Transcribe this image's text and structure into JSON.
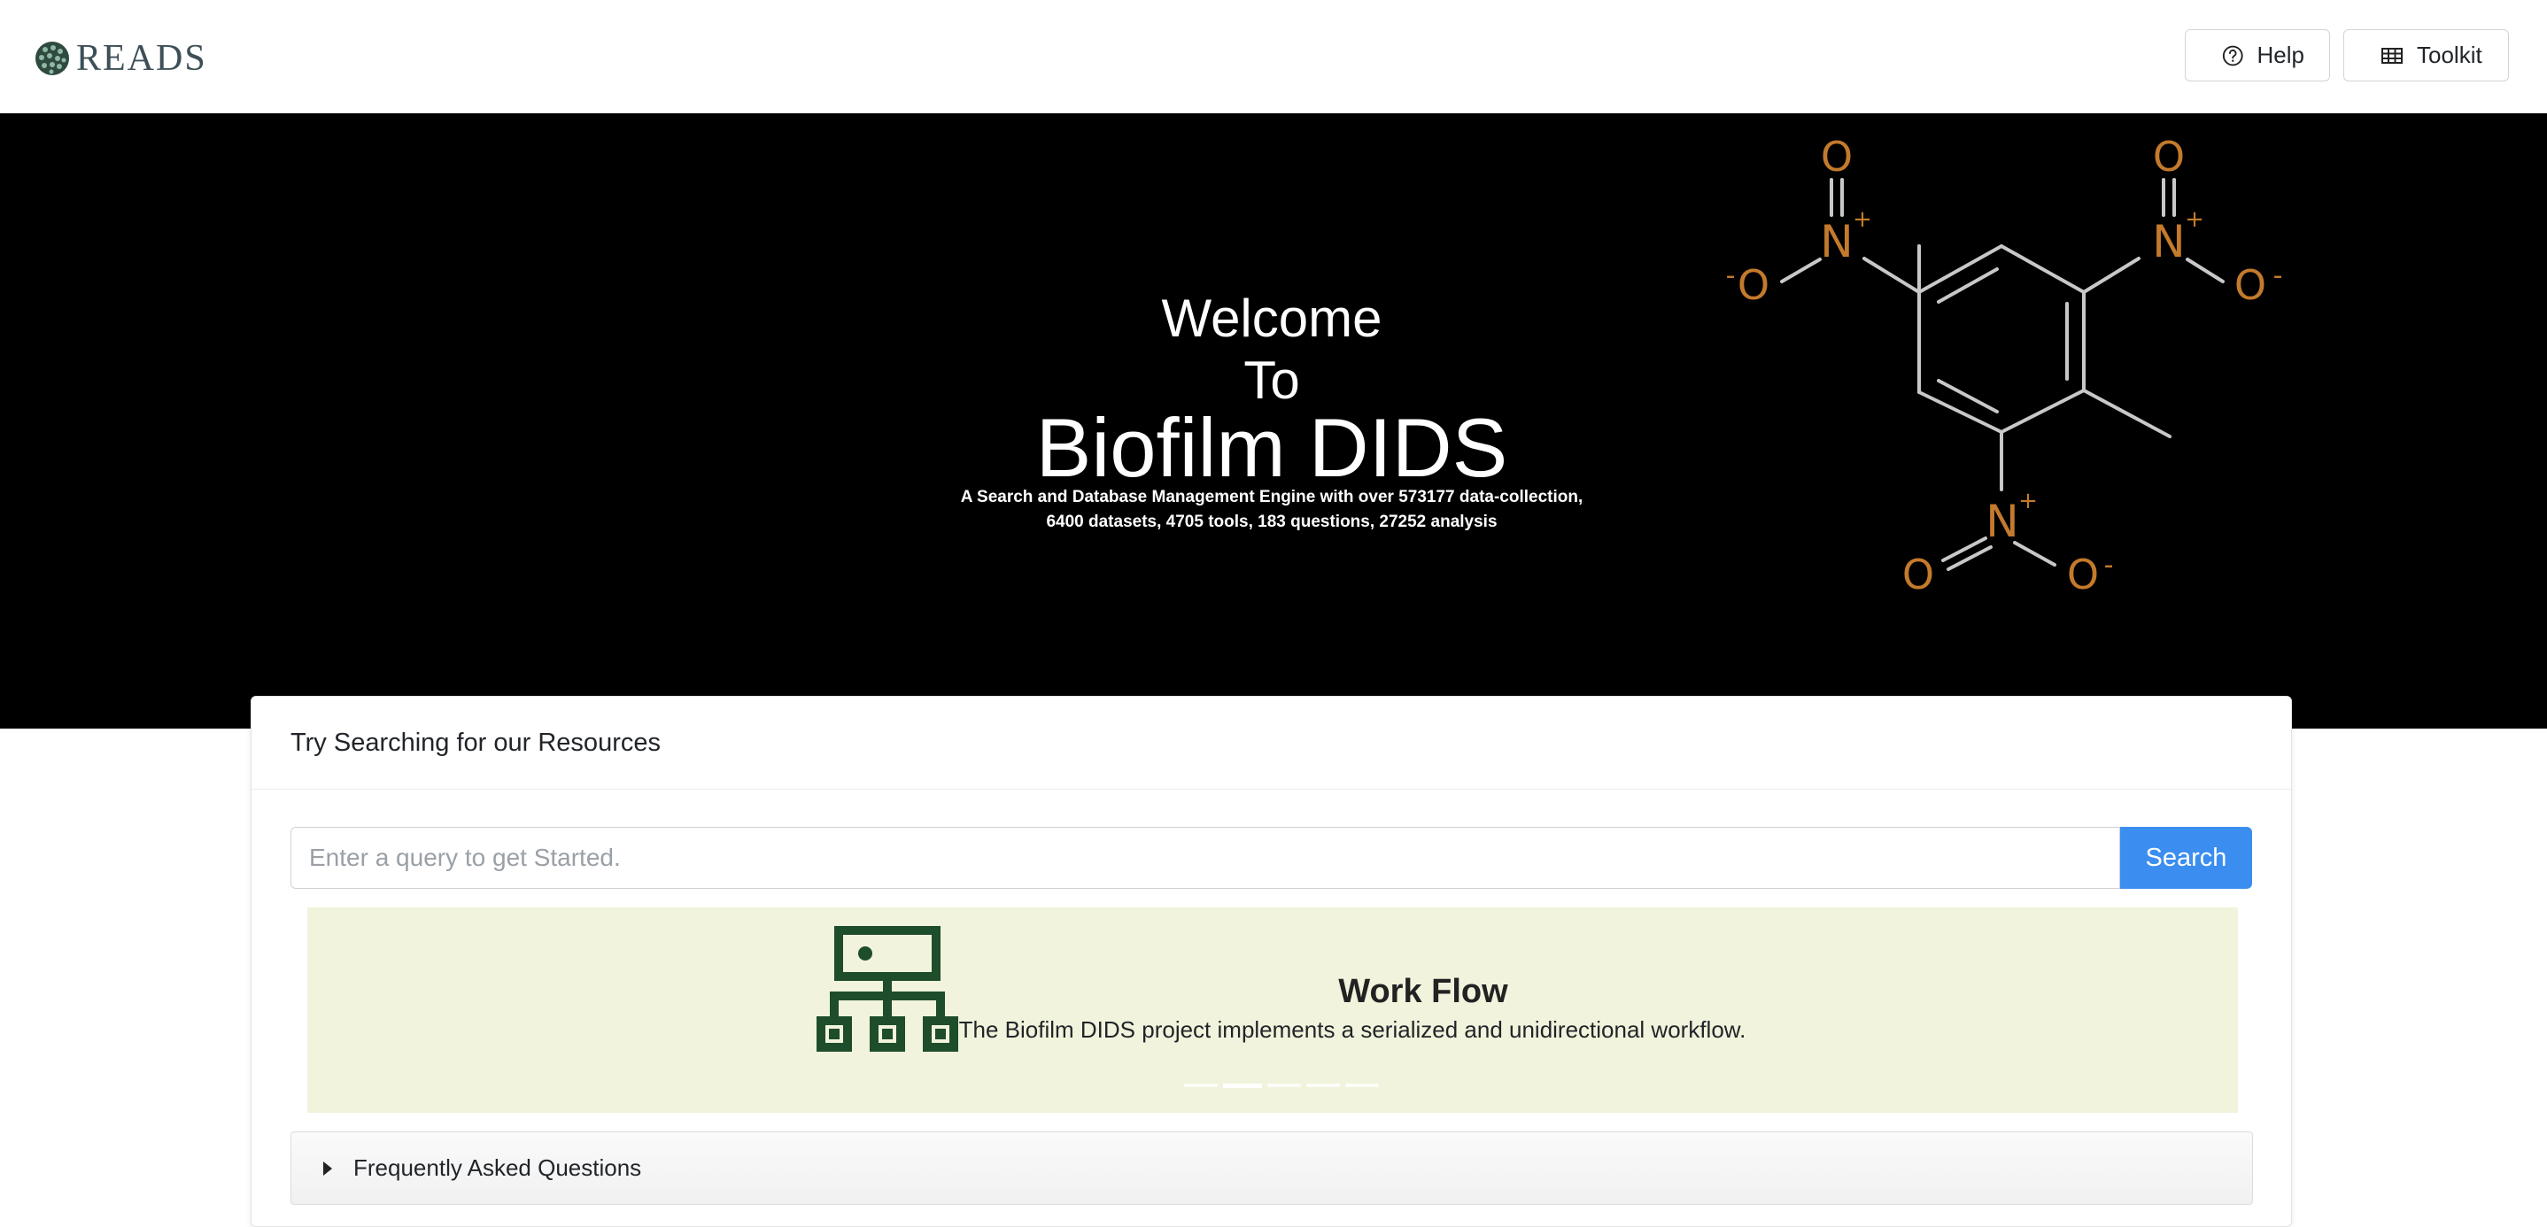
{
  "header": {
    "logo_text": "READS",
    "help_label": "Help",
    "toolkit_label": "Toolkit",
    "help_icon": "question-circle-icon",
    "toolkit_icon": "table-icon"
  },
  "hero": {
    "welcome": "Welcome",
    "to": "To",
    "title": "Biofilm DIDS",
    "tagline_line1": "A Search and Database Management Engine with over 573177 data-collection,",
    "tagline_line2": "6400 datasets, 4705 tools, 183 questions, 27252 analysis",
    "molecule_atoms": {
      "o": "O",
      "n": "N",
      "plus": "+",
      "minus": "-"
    }
  },
  "search_card": {
    "title": "Try Searching for our Resources",
    "placeholder": "Enter a query to get Started.",
    "button_label": "Search"
  },
  "carousel": {
    "slide_title": "Work Flow",
    "slide_text": "The Biofilm DIDS project implements a serialized and unidirectional workflow.",
    "slide_icon": "sitemap-icon",
    "slide_count": 5,
    "active_index": 1
  },
  "faq": {
    "label": "Frequently Asked Questions"
  },
  "colors": {
    "accent": "#3b8ef0",
    "carousel_bg": "#f1f3dc",
    "icon_green": "#1e4d2b",
    "atom_orange": "#c47a2c",
    "bond_gray": "#c8c8c8"
  }
}
